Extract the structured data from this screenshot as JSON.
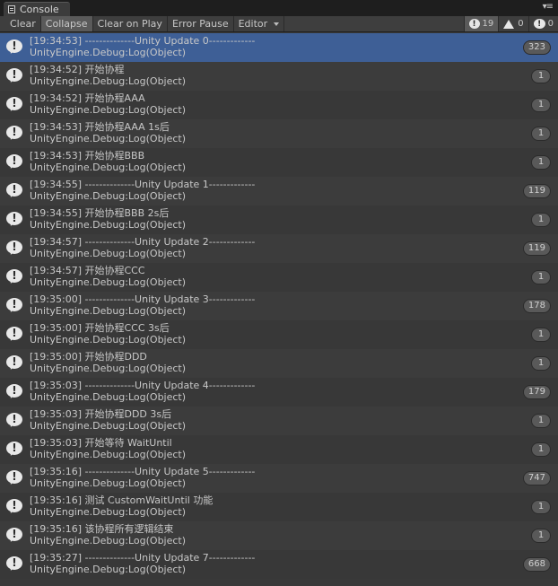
{
  "window": {
    "tab_label": "Console",
    "menu_glyph": "▾≡"
  },
  "toolbar": {
    "clear_label": "Clear",
    "collapse_label": "Collapse",
    "clear_on_play_label": "Clear on Play",
    "error_pause_label": "Error Pause",
    "editor_label": "Editor",
    "info_count": "19",
    "warn_count": "0",
    "error_count": "0"
  },
  "colors": {
    "selected_row": "#3e5f96",
    "background": "#393939"
  },
  "log": [
    {
      "line1": "[19:34:53] --------------Unity Update 0-------------",
      "line2": "UnityEngine.Debug:Log(Object)",
      "count": "323",
      "icon": "info-bubble-icon"
    },
    {
      "line1": "[19:34:52] 开始协程",
      "line2": "UnityEngine.Debug:Log(Object)",
      "count": "1",
      "icon": "info-bubble-icon"
    },
    {
      "line1": "[19:34:52] 开始协程AAA",
      "line2": "UnityEngine.Debug:Log(Object)",
      "count": "1",
      "icon": "info-bubble-icon"
    },
    {
      "line1": "[19:34:53] 开始协程AAA 1s后",
      "line2": "UnityEngine.Debug:Log(Object)",
      "count": "1",
      "icon": "info-bubble-icon"
    },
    {
      "line1": "[19:34:53] 开始协程BBB",
      "line2": "UnityEngine.Debug:Log(Object)",
      "count": "1",
      "icon": "info-bubble-icon"
    },
    {
      "line1": "[19:34:55] --------------Unity Update 1-------------",
      "line2": "UnityEngine.Debug:Log(Object)",
      "count": "119",
      "icon": "info-bubble-icon"
    },
    {
      "line1": "[19:34:55] 开始协程BBB 2s后",
      "line2": "UnityEngine.Debug:Log(Object)",
      "count": "1",
      "icon": "info-bubble-icon"
    },
    {
      "line1": "[19:34:57] --------------Unity Update 2-------------",
      "line2": "UnityEngine.Debug:Log(Object)",
      "count": "119",
      "icon": "info-bubble-icon"
    },
    {
      "line1": "[19:34:57] 开始协程CCC",
      "line2": "UnityEngine.Debug:Log(Object)",
      "count": "1",
      "icon": "info-bubble-icon"
    },
    {
      "line1": "[19:35:00] --------------Unity Update 3-------------",
      "line2": "UnityEngine.Debug:Log(Object)",
      "count": "178",
      "icon": "info-bubble-icon"
    },
    {
      "line1": "[19:35:00] 开始协程CCC 3s后",
      "line2": "UnityEngine.Debug:Log(Object)",
      "count": "1",
      "icon": "info-bubble-icon"
    },
    {
      "line1": "[19:35:00] 开始协程DDD",
      "line2": "UnityEngine.Debug:Log(Object)",
      "count": "1",
      "icon": "info-bubble-icon"
    },
    {
      "line1": "[19:35:03] --------------Unity Update 4-------------",
      "line2": "UnityEngine.Debug:Log(Object)",
      "count": "179",
      "icon": "info-bubble-icon"
    },
    {
      "line1": "[19:35:03] 开始协程DDD 3s后",
      "line2": "UnityEngine.Debug:Log(Object)",
      "count": "1",
      "icon": "info-bubble-icon"
    },
    {
      "line1": "[19:35:03] 开始等待 WaitUntil",
      "line2": "UnityEngine.Debug:Log(Object)",
      "count": "1",
      "icon": "info-bubble-icon"
    },
    {
      "line1": "[19:35:16] --------------Unity Update 5-------------",
      "line2": "UnityEngine.Debug:Log(Object)",
      "count": "747",
      "icon": "info-bubble-icon"
    },
    {
      "line1": "[19:35:16] 测试 CustomWaitUntil 功能",
      "line2": "UnityEngine.Debug:Log(Object)",
      "count": "1",
      "icon": "info-bubble-icon"
    },
    {
      "line1": "[19:35:16] 该协程所有逻辑结束",
      "line2": "UnityEngine.Debug:Log(Object)",
      "count": "1",
      "icon": "info-bubble-icon"
    },
    {
      "line1": "[19:35:27] --------------Unity Update 7-------------",
      "line2": "UnityEngine.Debug:Log(Object)",
      "count": "668",
      "icon": "info-bubble-icon"
    }
  ]
}
